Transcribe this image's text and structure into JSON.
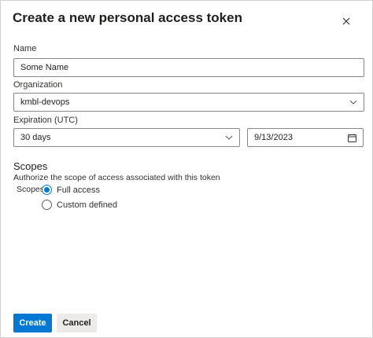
{
  "dialog": {
    "title": "Create a new personal access token",
    "close_icon": "close-icon"
  },
  "fields": {
    "name": {
      "label": "Name",
      "value": "Some Name"
    },
    "organization": {
      "label": "Organization",
      "value": "kmbl-devops"
    },
    "expiration": {
      "label": "Expiration (UTC)",
      "value": "30 days",
      "date": "9/13/2023"
    }
  },
  "scopes": {
    "title": "Scopes",
    "description": "Authorize the scope of access associated with this token",
    "label": "Scopes",
    "options": [
      {
        "label": "Full access",
        "selected": true
      },
      {
        "label": "Custom defined",
        "selected": false
      }
    ]
  },
  "buttons": {
    "create": "Create",
    "cancel": "Cancel"
  },
  "colors": {
    "accent": "#0078d4",
    "secondary_button": "#edebe9"
  }
}
